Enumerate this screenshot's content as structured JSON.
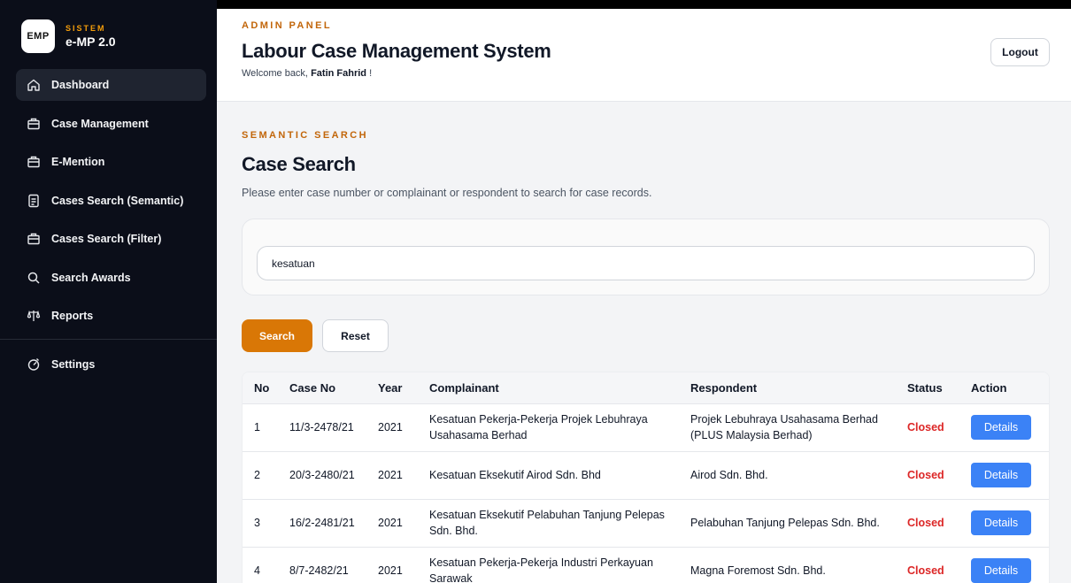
{
  "brand": {
    "logo": "EMP",
    "subtitle": "SISTEM",
    "title": "e-MP 2.0"
  },
  "sidebar": {
    "items": [
      {
        "label": "Dashboard",
        "icon": "home-icon",
        "active": true
      },
      {
        "label": "Case Management",
        "icon": "briefcase-icon"
      },
      {
        "label": "E-Mention",
        "icon": "briefcase-icon"
      },
      {
        "label": "Cases Search (Semantic)",
        "icon": "document-icon"
      },
      {
        "label": "Cases Search (Filter)",
        "icon": "briefcase-icon"
      },
      {
        "label": "Search Awards",
        "icon": "search-icon"
      },
      {
        "label": "Reports",
        "icon": "scale-icon"
      },
      {
        "label": "Settings",
        "icon": "settings-icon"
      }
    ]
  },
  "header": {
    "eyebrow": "ADMIN PANEL",
    "title": "Labour Case Management System",
    "welcome_prefix": "Welcome back,",
    "user_name": "Fatin Fahrid",
    "welcome_suffix": "!",
    "logout_label": "Logout"
  },
  "search": {
    "eyebrow": "SEMANTIC SEARCH",
    "title": "Case Search",
    "description": "Please enter case number or complainant or respondent to search for case records.",
    "query": "kesatuan",
    "search_label": "Search",
    "reset_label": "Reset"
  },
  "table": {
    "columns": [
      "No",
      "Case No",
      "Year",
      "Complainant",
      "Respondent",
      "Status",
      "Action"
    ],
    "rows": [
      {
        "no": "1",
        "case_no": "11/3-2478/21",
        "year": "2021",
        "complainant": "Kesatuan Pekerja-Pekerja Projek Lebuhraya Usahasama Berhad",
        "respondent": "Projek Lebuhraya Usahasama Berhad (PLUS Malaysia Berhad)",
        "status": "Closed",
        "action": "Details"
      },
      {
        "no": "2",
        "case_no": "20/3-2480/21",
        "year": "2021",
        "complainant": "Kesatuan Eksekutif Airod Sdn. Bhd",
        "respondent": "Airod Sdn. Bhd.",
        "status": "Closed",
        "action": "Details"
      },
      {
        "no": "3",
        "case_no": "16/2-2481/21",
        "year": "2021",
        "complainant": "Kesatuan Eksekutif Pelabuhan Tanjung Pelepas Sdn. Bhd.",
        "respondent": "Pelabuhan Tanjung Pelepas Sdn. Bhd.",
        "status": "Closed",
        "action": "Details"
      },
      {
        "no": "4",
        "case_no": "8/7-2482/21",
        "year": "2021",
        "complainant": "Kesatuan Pekerja-Pekerja Industri Perkayuan Sarawak",
        "respondent": "Magna Foremost Sdn. Bhd.",
        "status": "Closed",
        "action": "Details"
      }
    ]
  },
  "colors": {
    "sidebar_bg": "#0b0e19",
    "accent": "#d97706",
    "status_closed": "#dc2626",
    "details_button": "#3b82f6"
  }
}
